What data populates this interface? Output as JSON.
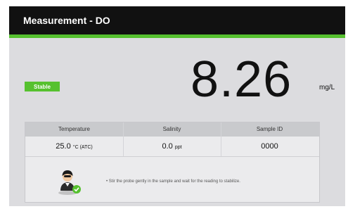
{
  "window": {
    "title": "Measurement - DO"
  },
  "status": {
    "label": "Stable",
    "color": "#56c12f"
  },
  "reading": {
    "value": "8.26",
    "unit": "mg/L"
  },
  "table": {
    "headers": [
      "Temperature",
      "Salinity",
      "Sample ID"
    ],
    "values": [
      {
        "value": "25.0",
        "unit": "°C (ATC)"
      },
      {
        "value": "0.0",
        "unit": "ppt"
      },
      {
        "value": "0000",
        "unit": ""
      }
    ]
  },
  "hint": {
    "text": "Stir the probe gently in the sample and wait for the reading to stabilize."
  },
  "icons": {
    "operator": "operator-icon",
    "check": "check-icon"
  },
  "colors": {
    "accent": "#56c12f",
    "titlebar": "#111111",
    "background": "#dcdcdf"
  }
}
